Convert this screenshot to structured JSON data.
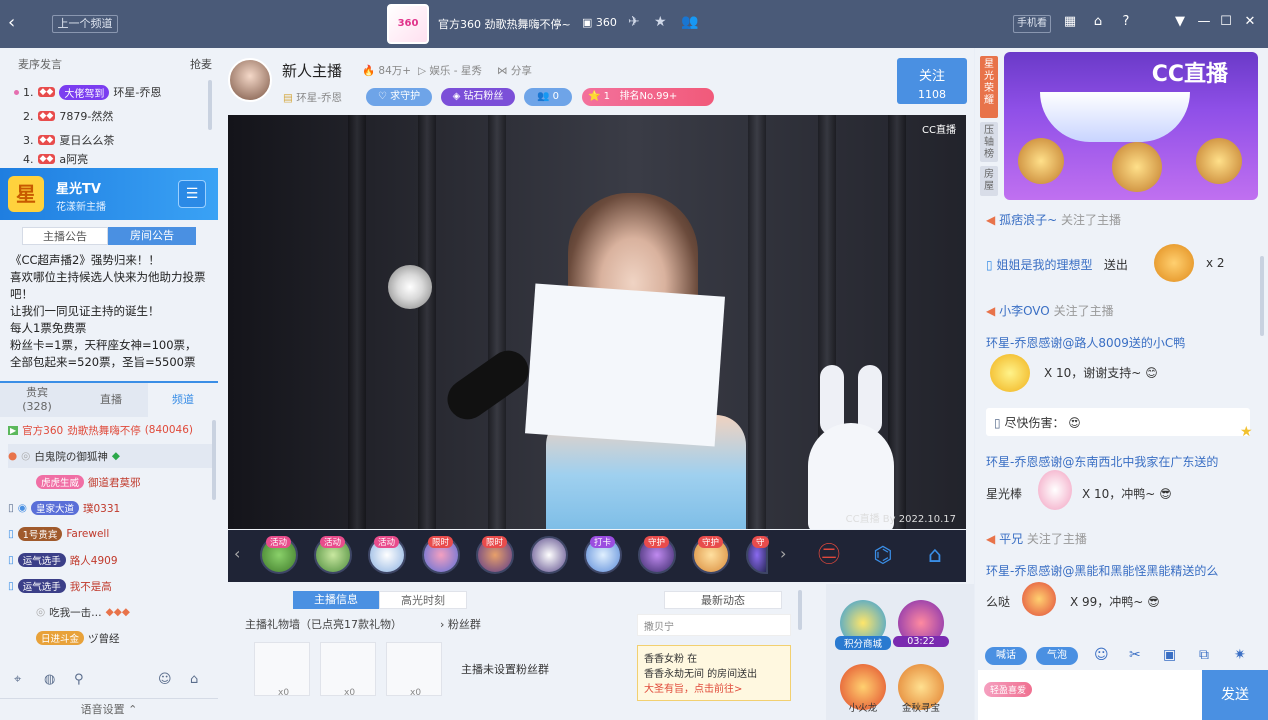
{
  "topbar": {
    "back_glyph": "‹",
    "prev_channel": "上一个频道",
    "channel_logo": "360",
    "channel_name": "官方360 劲歌热舞嗨不停~",
    "channel_id": "360",
    "phone_view": "手机看",
    "icons": [
      "grid-icon",
      "bell-icon",
      "help-icon",
      "dropdown-icon",
      "minimize-icon",
      "maximize-icon",
      "close-icon"
    ]
  },
  "left": {
    "rank_header": "麦序发言",
    "rank_grab": "抢麦",
    "ranks": [
      {
        "num": "1.",
        "badge": "大佬驾到",
        "name": "环星-乔恩"
      },
      {
        "num": "2.",
        "badge": "",
        "name": "7879-然然"
      },
      {
        "num": "3.",
        "badge": "",
        "name": "夏日么么茶"
      },
      {
        "num": "4.",
        "badge": "",
        "name": "a阿亮"
      }
    ],
    "channel_title": "星光TV",
    "channel_sub": "花漾新主播",
    "channel_logo_char": "星",
    "tabs": [
      "主播公告",
      "房间公告"
    ],
    "notice": [
      "《CC超声播2》强势归来！！",
      "喜欢哪位主持候选人快来为他助力投票吧！",
      "让我们一同见证主持的诞生！",
      "每人1票免费票",
      "粉丝卡=1票，天秤座女神=100票，",
      "全部包起来=520票，圣旨=5500票"
    ],
    "lower_tabs": [
      "贵宾",
      "(328)",
      "直播",
      "频道"
    ],
    "channel_row": {
      "name": "官方360",
      "desc": "劲歌热舞嗨不停",
      "id": "(840046)"
    },
    "members": [
      {
        "name": "白鬼院の御狐神",
        "badge": ""
      },
      {
        "name": "御道君莫邪",
        "badge": "虎虎生威"
      },
      {
        "name": "璞0331",
        "badge": "皇家大道"
      },
      {
        "name": "Farewell",
        "badge": "1号贵宾"
      },
      {
        "name": "路人4909",
        "badge": "运气选手"
      },
      {
        "name": "我不是高",
        "badge": "运气选手"
      },
      {
        "name": "吃我一击…",
        "badge": ""
      },
      {
        "name": "ヅ曾经",
        "badge": "日进斗金"
      }
    ],
    "voice_settings": "语音设置"
  },
  "center": {
    "anchor_name": "新人主播",
    "heat": "84万+",
    "category": "娱乐 - 星秀",
    "share": "分享",
    "guild": "环星-乔恩",
    "guard": "求守护",
    "diamond_fans": "钻石粉丝",
    "fans_count": "0",
    "rank_num": "1",
    "rank_text": "排名No.99+",
    "follow": "关注",
    "follow_count": "1108",
    "video_watermark": "CC直播",
    "video_timestamp": "CC直播 By 2022.10.17",
    "gift_tags": [
      "活动",
      "活动",
      "活动",
      "限时",
      "限时",
      "",
      "打卡",
      "守护",
      "守护",
      "守"
    ],
    "info_tabs": [
      "主播信息",
      "高光时刻"
    ],
    "gift_wall": "主播礼物墙（已点亮17款礼物）",
    "fan_group": "粉丝群",
    "gift_counts": [
      "x0",
      "x0",
      "x0"
    ],
    "no_fan_group": "主播未设置粉丝群",
    "news_tab": "最新动态",
    "news_top": "撒贝宁",
    "news_lines": [
      "香香女粉 在",
      "香香永劫无间 的房间送出",
      "大圣有旨，点击前往>"
    ],
    "activities": [
      {
        "label": "积分商城"
      },
      {
        "label": "03:22"
      },
      {
        "label": "小火龙"
      },
      {
        "label": "金秋寻宝"
      }
    ]
  },
  "right": {
    "side_tabs": [
      "星光荣耀",
      "压轴榜",
      "房屋"
    ],
    "banner_brand": "CC直播",
    "chat": [
      {
        "user": "孤痞浪子~",
        "text": "关注了主播"
      },
      {
        "user": "姐姐是我的理想型",
        "text": "送出",
        "count": "x 2"
      },
      {
        "user": "小李OVO",
        "text": "关注了主播"
      },
      {
        "user": "环星-乔恩感谢",
        "text": "@路人8009送的小C鸭"
      },
      {
        "count": "X 10，谢谢支持~"
      },
      {
        "user": "尽快伤害：",
        "text": ""
      },
      {
        "user": "环星-乔恩感谢",
        "text": "@东南西北中我家在广东送的"
      },
      {
        "text": "星光棒",
        "count": "X 10，冲鸭~"
      },
      {
        "user": "平兄",
        "text": "关注了主播"
      },
      {
        "user": "环星-乔恩感谢",
        "text": "@黑能和黑能怪黑能精送的么"
      },
      {
        "text": "么哒",
        "count": "X 99，冲鸭~"
      }
    ],
    "tool_pills": [
      "喊话",
      "气泡"
    ],
    "send": "发送",
    "bubble_label": "轻盈喜爱"
  },
  "colors": {
    "accent": "#4a90e2",
    "topbar": "#4a5a78",
    "gift_bar": "#1f2436"
  }
}
